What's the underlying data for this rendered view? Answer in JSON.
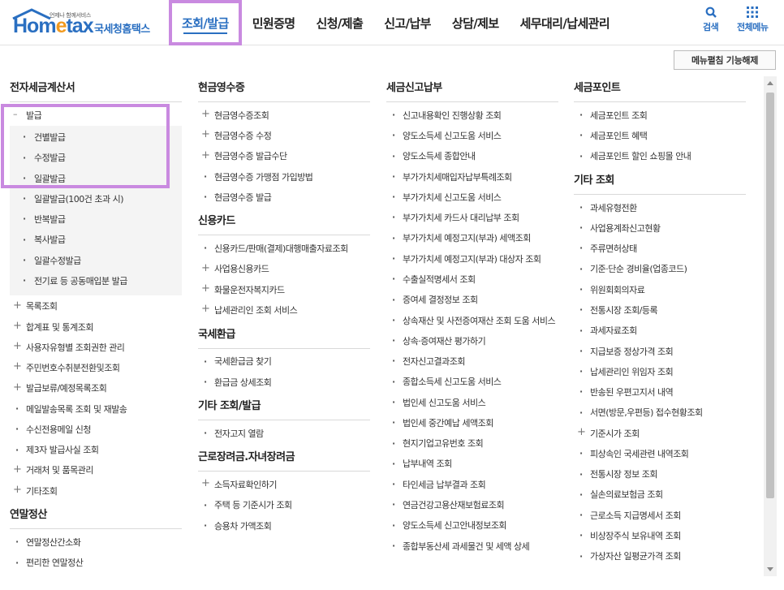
{
  "logo": {
    "tagline": "언제나 함께서비스",
    "brand_main": "Hom",
    "brand_e": "e",
    "brand_tail": "tax",
    "brand_korean": "국세청홈택스"
  },
  "gnb": [
    {
      "label": "조회/발급",
      "active": true
    },
    {
      "label": "민원증명"
    },
    {
      "label": "신청/제출"
    },
    {
      "label": "신고/납부"
    },
    {
      "label": "상담/제보"
    },
    {
      "label": "세무대리/납세관리"
    }
  ],
  "util": {
    "search_label": "검색",
    "all_menu_label": "전체메뉴"
  },
  "menu_close_button": "메뉴펼침 기능해제",
  "col1": {
    "title": "전자세금계산서",
    "issue": {
      "label": "발급",
      "children": [
        "건별발급",
        "수정발급",
        "일괄발급",
        "일괄발급(100건 초과 시)",
        "반복발급",
        "복사발급",
        "일괄수정발급",
        "전기료 등 공동매입분 발급"
      ]
    },
    "items": [
      "목록조회",
      "합계표 및 통계조회",
      "사용자유형별 조회권한 관리",
      "주민번호수취분전환및조회",
      "발급보류/예정목록조회",
      "메일발송목록 조회 및 재발송",
      "수신전용메일 신청",
      "제3자 발급사실 조회",
      "거래처 및 품목관리",
      "기타조회"
    ],
    "plus_flags": [
      true,
      true,
      true,
      true,
      true,
      false,
      false,
      false,
      true,
      true
    ],
    "sec2_title": "연말정산",
    "sec2_items": [
      "연말정산간소화",
      "편리한 연말정산"
    ]
  },
  "col2": {
    "sections": [
      {
        "title": "현금영수증",
        "items": [
          "현금영수증조회",
          "현금영수증 수정",
          "현금영수증 발급수단",
          "현금영수증 가맹점 가입방법",
          "현금영수증 발급"
        ],
        "plus": [
          true,
          true,
          true,
          false,
          false
        ]
      },
      {
        "title": "신용카드",
        "items": [
          "신용카드/판매(결제)대행매출자료조회",
          "사업용신용카드",
          "화물운전자복지카드",
          "납세관리인 조회 서비스"
        ],
        "plus": [
          false,
          true,
          true,
          true
        ]
      },
      {
        "title": "국세환급",
        "items": [
          "국세환급금 찾기",
          "환급금 상세조회"
        ],
        "plus": [
          false,
          false
        ]
      },
      {
        "title": "기타 조회/발급",
        "items": [
          "전자고지 열람"
        ],
        "plus": [
          false
        ]
      },
      {
        "title": "근로장려금.자녀장려금",
        "items": [
          "소득자료확인하기",
          "주택 등 기준시가 조회",
          "승용차 가액조회"
        ],
        "plus": [
          true,
          false,
          false
        ]
      }
    ]
  },
  "col3": {
    "title": "세금신고납부",
    "items": [
      "신고내용확인 진행상황 조회",
      "양도소득세 신고도움 서비스",
      "양도소득세 종합안내",
      "부가가치세매입자납부특례조회",
      "부가가치세 신고도움 서비스",
      "부가가치세 카드사 대리납부 조회",
      "부가가치세 예정고지(부과) 세액조회",
      "부가가치세 예정고지(부과) 대상자 조회",
      "수출실적명세서 조회",
      "증여세 결정정보 조회",
      "상속재산 및 사전증여재산 조회 도움 서비스",
      "상속·증여재산 평가하기",
      "전자신고결과조회",
      "종합소득세 신고도움 서비스",
      "법인세 신고도움 서비스",
      "법인세 중간예납 세액조회",
      "현지기업고유번호 조회",
      "납부내역 조회",
      "타인세금 납부결과 조회",
      "연금건강고용산재보험료조회",
      "양도소득세 신고안내정보조회",
      "종합부동산세 과세물건 및 세액 상세"
    ]
  },
  "col4": {
    "sections": [
      {
        "title": "세금포인트",
        "items": [
          "세금포인트 조회",
          "세금포인트 혜택",
          "세금포인트 할인 쇼핑몰 안내"
        ],
        "plus": [
          false,
          false,
          false
        ]
      },
      {
        "title": "기타 조회",
        "items": [
          "과세유형전환",
          "사업용계좌신고현황",
          "주류면허상태",
          "기준·단순 경비율(업종코드)",
          "위원회회의자료",
          "전통시장 조회/등록",
          "과세자료조회",
          "지급보증 정상가격 조회",
          "납세관리인 위임자 조회",
          "반송된 우편고지서 내역",
          "서면(방문,우편등) 접수현황조회",
          "기준시가 조회",
          "피상속인 국세관련 내역조회",
          "전통시장 정보 조회",
          "실손의료보험금 조회",
          "근로소득 지급명세서 조회",
          "비상장주식 보유내역 조회",
          "가상자산 일평균가격 조회"
        ],
        "plus": [
          false,
          false,
          false,
          false,
          false,
          false,
          false,
          false,
          false,
          false,
          false,
          true,
          false,
          false,
          false,
          false,
          false,
          false
        ]
      }
    ]
  }
}
